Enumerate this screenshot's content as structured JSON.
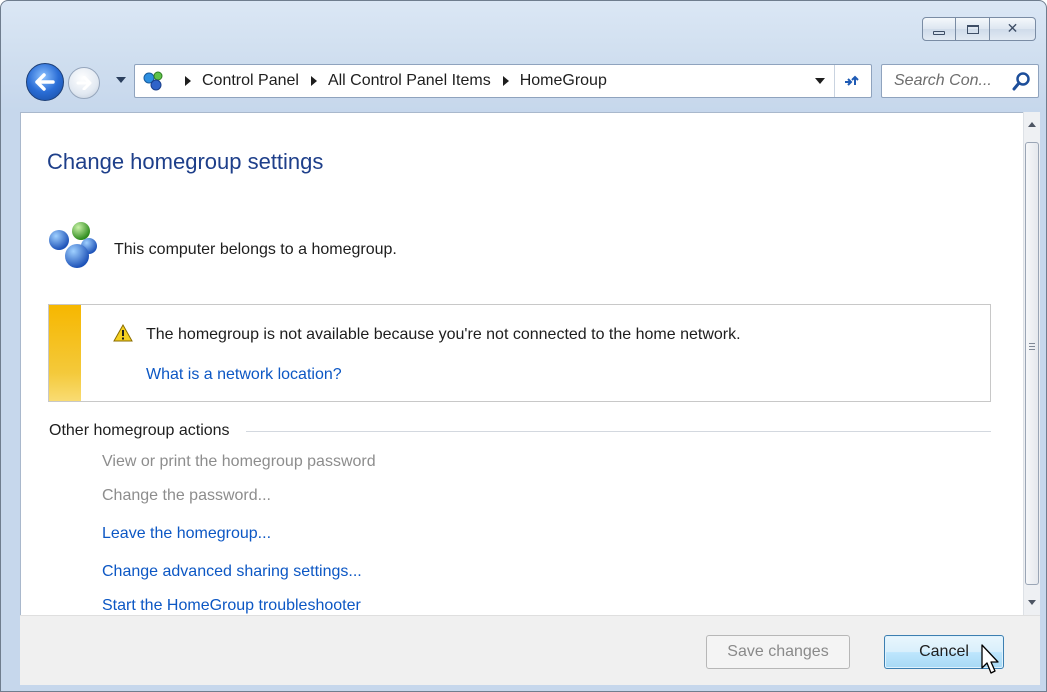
{
  "window": {
    "caption_icons": [
      "minimize-icon",
      "maximize-icon",
      "close-icon"
    ]
  },
  "navigation": {
    "breadcrumbs": [
      "Control Panel",
      "All Control Panel Items",
      "HomeGroup"
    ],
    "search_placeholder": "Search Con..."
  },
  "main": {
    "title": "Change homegroup settings",
    "status_text": "This computer belongs to a homegroup.",
    "notice": {
      "message": "The homegroup is not available because you're not connected to the home network.",
      "link": "What is a network location?"
    },
    "section_title": "Other homegroup actions",
    "actions": [
      {
        "label": "View or print the homegroup password",
        "enabled": false
      },
      {
        "label": "Change the password...",
        "enabled": false
      },
      {
        "label": "Leave the homegroup...",
        "enabled": true
      },
      {
        "label": "Change advanced sharing settings...",
        "enabled": true
      },
      {
        "label": "Start the HomeGroup troubleshooter",
        "enabled": true
      }
    ]
  },
  "footer": {
    "save_label": "Save changes",
    "cancel_label": "Cancel"
  },
  "colors": {
    "title": "#1e3f8a",
    "link": "#0c57c4",
    "disabled": "#8d8d8d",
    "warning_bar": "#f6b700"
  }
}
